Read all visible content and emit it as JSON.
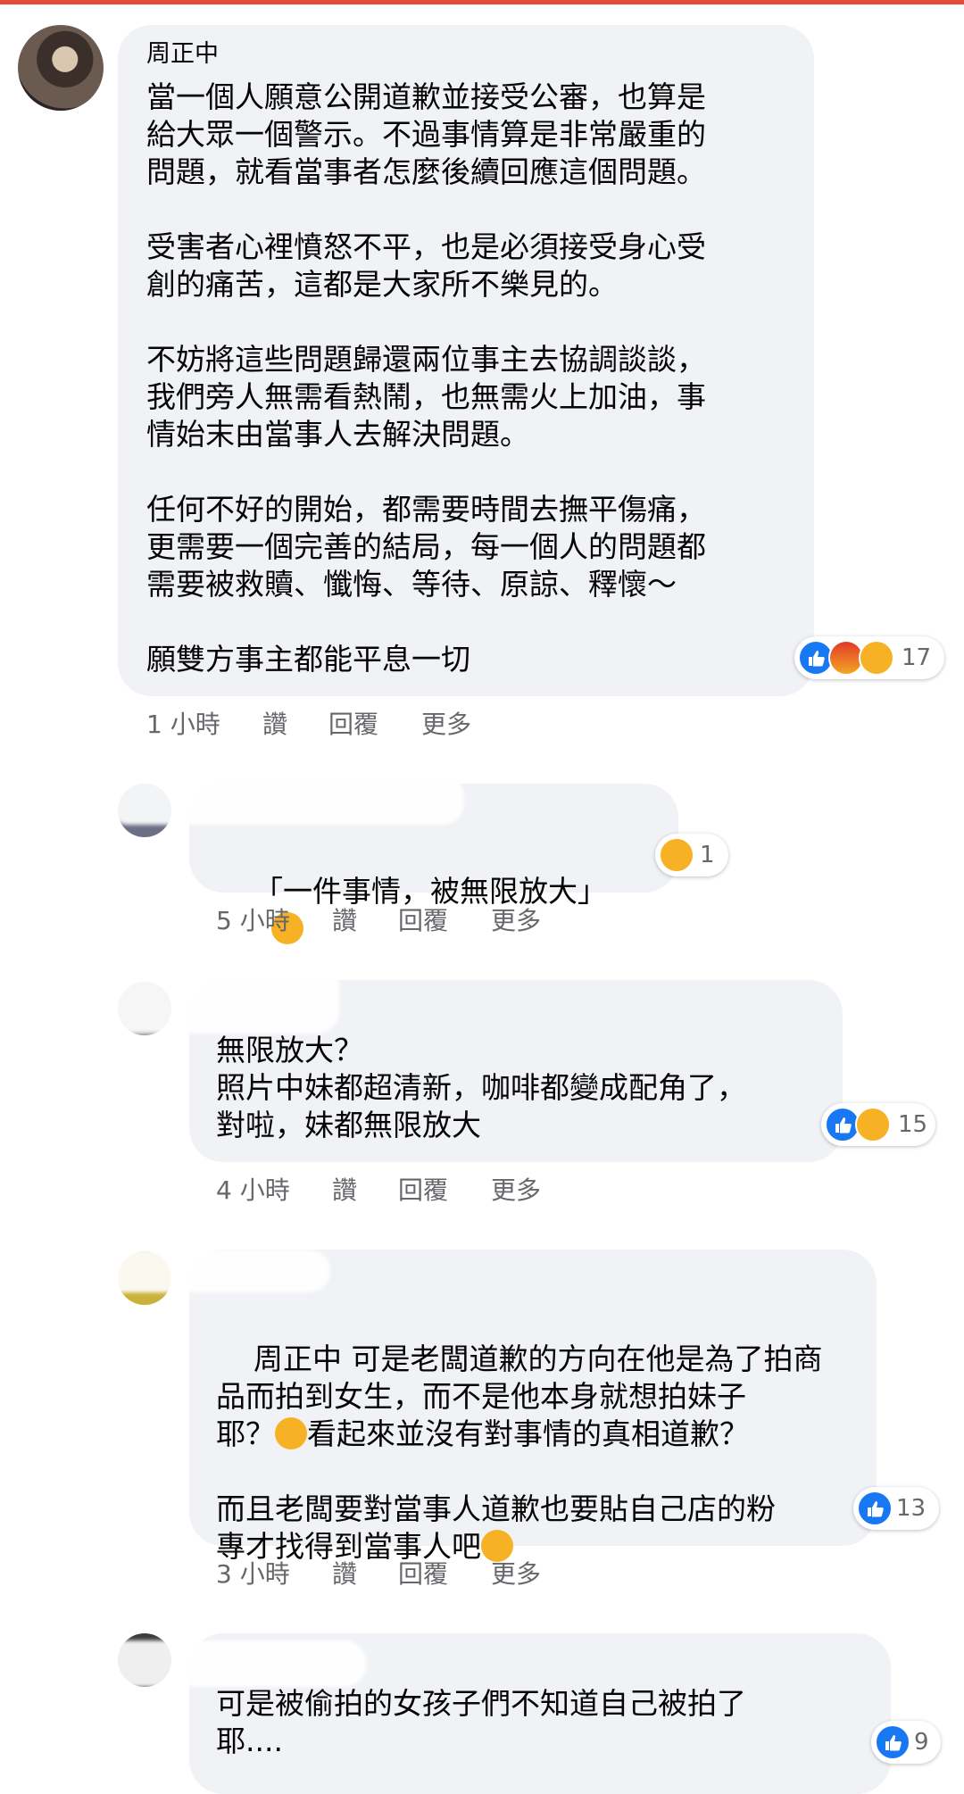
{
  "comments": [
    {
      "author": "周正中",
      "text": "當一個人願意公開道歉並接受公審，也算是\n給大眾一個警示。不過事情算是非常嚴重的\n問題，就看當事者怎麼後續回應這個問題。\n\n受害者心裡憤怒不平，也是必須接受身心受\n創的痛苦，這都是大家所不樂見的。\n\n不妨將這些問題歸還兩位事主去協調談談，\n我們旁人無需看熱鬧，也無需火上加油，事\n情始末由當事人去解決問題。\n\n任何不好的開始，都需要時間去撫平傷痛，\n更需要一個完善的結局，每一個人的問題都\n需要被救贖、懺悔、等待、原諒、釋懷～\n\n願雙方事主都能平息一切",
      "time": "1 小時",
      "like": "讚",
      "reply": "回覆",
      "more": "更多",
      "reaction_count": "17",
      "reactions": [
        "like-icon",
        "angry-icon",
        "care-icon"
      ]
    },
    {
      "author": "",
      "text": "「一件事情，被無限放大」",
      "time": "5 小時",
      "like": "讚",
      "reply": "回覆",
      "more": "更多",
      "reaction_count": "1",
      "reactions": [
        "care-icon"
      ]
    },
    {
      "author": "",
      "text": "無限放大？\n照片中妹都超清新，咖啡都變成配角了，\n對啦，妹都無限放大",
      "time": "4 小時",
      "like": "讚",
      "reply": "回覆",
      "more": "更多",
      "reaction_count": "15",
      "reactions": [
        "like-icon",
        "haha-icon"
      ]
    },
    {
      "author": "",
      "text_part1": "周正中 可是老闆道歉的方向在他是為了拍商\n品而拍到女生，而不是他本身就想拍妹子\n耶？",
      "text_part2": "看起來並沒有對事情的真相道歉？\n\n而且老闆要對當事人道歉也要貼自己店的粉\n專才找得到當事人吧",
      "time": "3 小時",
      "like": "讚",
      "reply": "回覆",
      "more": "更多",
      "reaction_count": "13",
      "reactions": [
        "like-icon"
      ]
    },
    {
      "author": "",
      "text": "可是被偷拍的女孩子們不知道自己被拍了\n耶....",
      "reaction_count": "9",
      "reactions": [
        "like-icon"
      ]
    }
  ],
  "colors": {
    "bubble": "#f0f2f5",
    "meta": "#65676b",
    "like": "#1877f2",
    "topbar": "#e44d3a"
  }
}
